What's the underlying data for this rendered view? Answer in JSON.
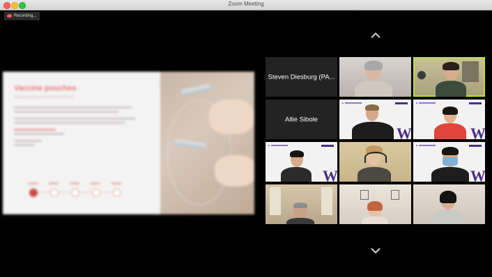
{
  "window": {
    "title": "Zoom Meeting"
  },
  "recording": {
    "label": "Recording..."
  },
  "share": {
    "slide_title": "Vaccine pouches",
    "slide_subtitle": "Dosage pouch and needle-free delivery"
  },
  "gallery": {
    "tiles": [
      {
        "name": "Steven Diesburg (PA...",
        "video": false
      },
      {
        "name": "",
        "video": true
      },
      {
        "name": "",
        "video": true,
        "active": true
      },
      {
        "name": "Allie Sibole",
        "video": false
      },
      {
        "name": "",
        "video": true
      },
      {
        "name": "",
        "video": true
      },
      {
        "name": "",
        "video": true
      },
      {
        "name": "",
        "video": true
      },
      {
        "name": "",
        "video": true
      },
      {
        "name": "",
        "video": true
      },
      {
        "name": "",
        "video": true
      },
      {
        "name": "",
        "video": true
      }
    ]
  },
  "colors": {
    "active_speaker": "#b7e13a",
    "uw_purple": "#4b2e83",
    "recording": "#ff5a5a"
  },
  "icons": {
    "recording": "cloud-record-icon",
    "prev": "chevron-up-icon",
    "next": "chevron-down-icon"
  }
}
